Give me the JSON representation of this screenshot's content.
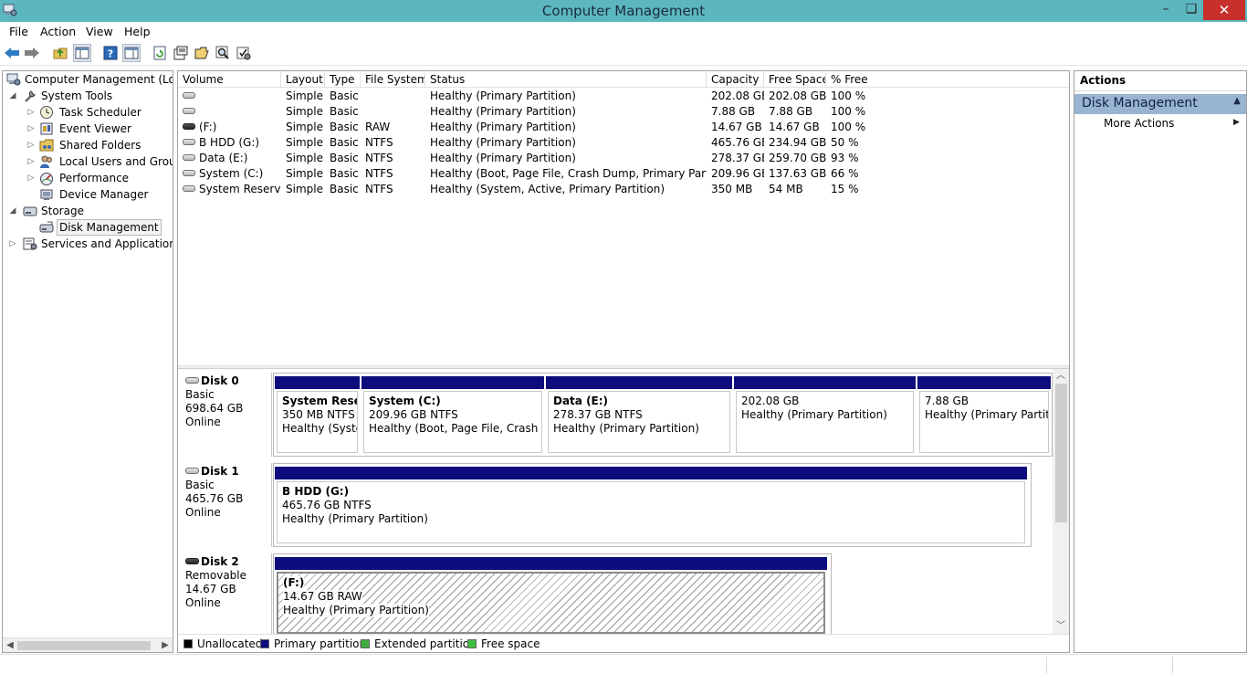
{
  "window": {
    "title": "Computer Management",
    "min_glyph": "–",
    "max_glyph": "❏",
    "close_glyph": "✕"
  },
  "menu": [
    "File",
    "Action",
    "View",
    "Help"
  ],
  "tree": {
    "root": "Computer Management (Local)",
    "system_tools": "System Tools",
    "task_scheduler": "Task Scheduler",
    "event_viewer": "Event Viewer",
    "shared_folders": "Shared Folders",
    "local_users": "Local Users and Groups",
    "performance": "Performance",
    "device_manager": "Device Manager",
    "storage": "Storage",
    "disk_management": "Disk Management",
    "services": "Services and Applications"
  },
  "volume_columns": [
    "Volume",
    "Layout",
    "Type",
    "File System",
    "Status",
    "Capacity",
    "Free Space",
    "% Free"
  ],
  "volumes": [
    {
      "name": "",
      "layout": "Simple",
      "type": "Basic",
      "fs": "",
      "status": "Healthy (Primary Partition)",
      "capacity": "202.08 GB",
      "free": "202.08 GB",
      "pct": "100 %",
      "icon": "disk-icon"
    },
    {
      "name": "",
      "layout": "Simple",
      "type": "Basic",
      "fs": "",
      "status": "Healthy (Primary Partition)",
      "capacity": "7.88 GB",
      "free": "7.88 GB",
      "pct": "100 %",
      "icon": "disk-icon"
    },
    {
      "name": "(F:)",
      "layout": "Simple",
      "type": "Basic",
      "fs": "RAW",
      "status": "Healthy (Primary Partition)",
      "capacity": "14.67 GB",
      "free": "14.67 GB",
      "pct": "100 %",
      "icon": "removable-disk-icon"
    },
    {
      "name": "B HDD (G:)",
      "layout": "Simple",
      "type": "Basic",
      "fs": "NTFS",
      "status": "Healthy (Primary Partition)",
      "capacity": "465.76 GB",
      "free": "234.94 GB",
      "pct": "50 %",
      "icon": "disk-icon"
    },
    {
      "name": "Data (E:)",
      "layout": "Simple",
      "type": "Basic",
      "fs": "NTFS",
      "status": "Healthy (Primary Partition)",
      "capacity": "278.37 GB",
      "free": "259.70 GB",
      "pct": "93 %",
      "icon": "disk-icon"
    },
    {
      "name": "System (C:)",
      "layout": "Simple",
      "type": "Basic",
      "fs": "NTFS",
      "status": "Healthy (Boot, Page File, Crash Dump, Primary Partition)",
      "capacity": "209.96 GB",
      "free": "137.63 GB",
      "pct": "66 %",
      "icon": "disk-icon"
    },
    {
      "name": "System Reserved",
      "layout": "Simple",
      "type": "Basic",
      "fs": "NTFS",
      "status": "Healthy (System, Active, Primary Partition)",
      "capacity": "350 MB",
      "free": "54 MB",
      "pct": "15 %",
      "icon": "disk-icon"
    }
  ],
  "disks": [
    {
      "name": "Disk 0",
      "type": "Basic",
      "size": "698.64 GB",
      "state": "Online",
      "partitions": [
        {
          "name": "System Reserv",
          "size": "350 MB NTFS",
          "status": "Healthy (Syster"
        },
        {
          "name": "System  (C:)",
          "size": "209.96 GB NTFS",
          "status": "Healthy (Boot, Page File, Crash Dur"
        },
        {
          "name": "Data  (E:)",
          "size": "278.37 GB NTFS",
          "status": "Healthy (Primary Partition)"
        },
        {
          "name": "",
          "size": "202.08 GB",
          "status": "Healthy (Primary Partition)"
        },
        {
          "name": "",
          "size": "7.88 GB",
          "status": "Healthy (Primary Partitior"
        }
      ]
    },
    {
      "name": "Disk 1",
      "type": "Basic",
      "size": "465.76 GB",
      "state": "Online",
      "partitions": [
        {
          "name": "B HDD  (G:)",
          "size": "465.76 GB NTFS",
          "status": "Healthy (Primary Partition)"
        }
      ]
    },
    {
      "name": "Disk 2",
      "type": "Removable",
      "size": "14.67 GB",
      "state": "Online",
      "partitions": [
        {
          "name": "(F:)",
          "size": "14.67 GB RAW",
          "status": "Healthy (Primary Partition)"
        }
      ]
    }
  ],
  "legend": [
    {
      "label": "Unallocated",
      "color": "#000000"
    },
    {
      "label": "Primary partition",
      "color": "#0c0c7c"
    },
    {
      "label": "Extended partition",
      "color": "#3fae3f"
    },
    {
      "label": "Free space",
      "color": "#3fbf3f"
    }
  ],
  "actions": {
    "header": "Actions",
    "section": "Disk Management",
    "more": "More Actions"
  },
  "colors": {
    "titlebar": "#5cb6bf",
    "close": "#c7302b",
    "primary_partition": "#0c0c7c",
    "actions_section": "#99b4d1"
  }
}
